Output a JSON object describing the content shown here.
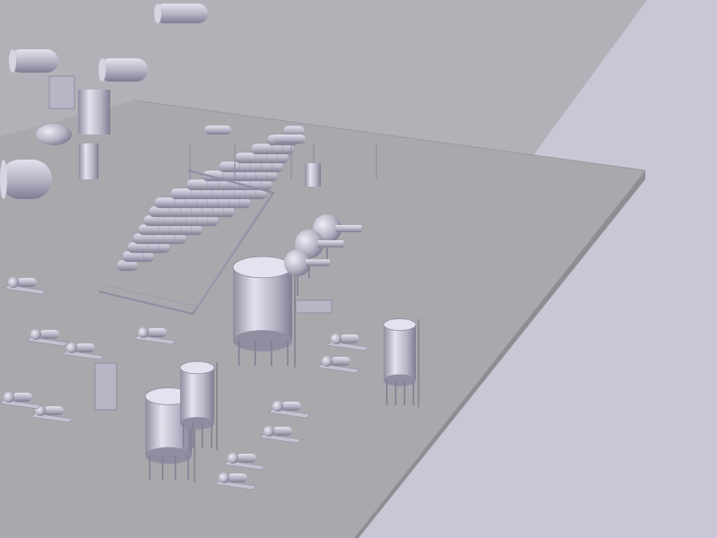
{
  "scene": {
    "background_color": "#c9c6d6",
    "upper_floor_color": "#b3b1b8",
    "lower_floor_color": "#a8a7ab",
    "floor_edge_color": "#8e8d92",
    "equipment_color": "#b8b6c6",
    "equipment_shadow_color": "#8f8da0",
    "equipment_highlight_color": "#e4e2ee",
    "equipment_types": [
      "vertical-storage-tank",
      "horizontal-vessel",
      "centrifugal-pump-skid",
      "heat-exchanger-bank",
      "spherical-separator",
      "pipe-rack",
      "compressor-unit",
      "control-cabinet"
    ]
  }
}
